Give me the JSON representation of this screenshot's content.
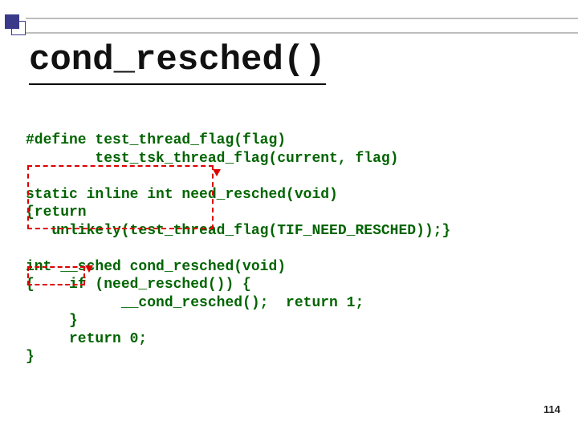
{
  "title": "cond_resched()",
  "code": {
    "l0": "#define test_thread_flag(flag)",
    "l1": "        test_tsk_thread_flag(current, flag)",
    "l2": "",
    "l3": "static inline int need_resched(void)",
    "l4": "{return",
    "l5": "   unlikely(test_thread_flag(TIF_NEED_RESCHED));}",
    "l6": "",
    "l7": "int __sched cond_resched(void)",
    "l8": "{    if (need_resched()) {",
    "l9": "           __cond_resched();  return 1;",
    "l10": "     }",
    "l11": "     return 0;",
    "l12": "}"
  },
  "page_number": "114"
}
